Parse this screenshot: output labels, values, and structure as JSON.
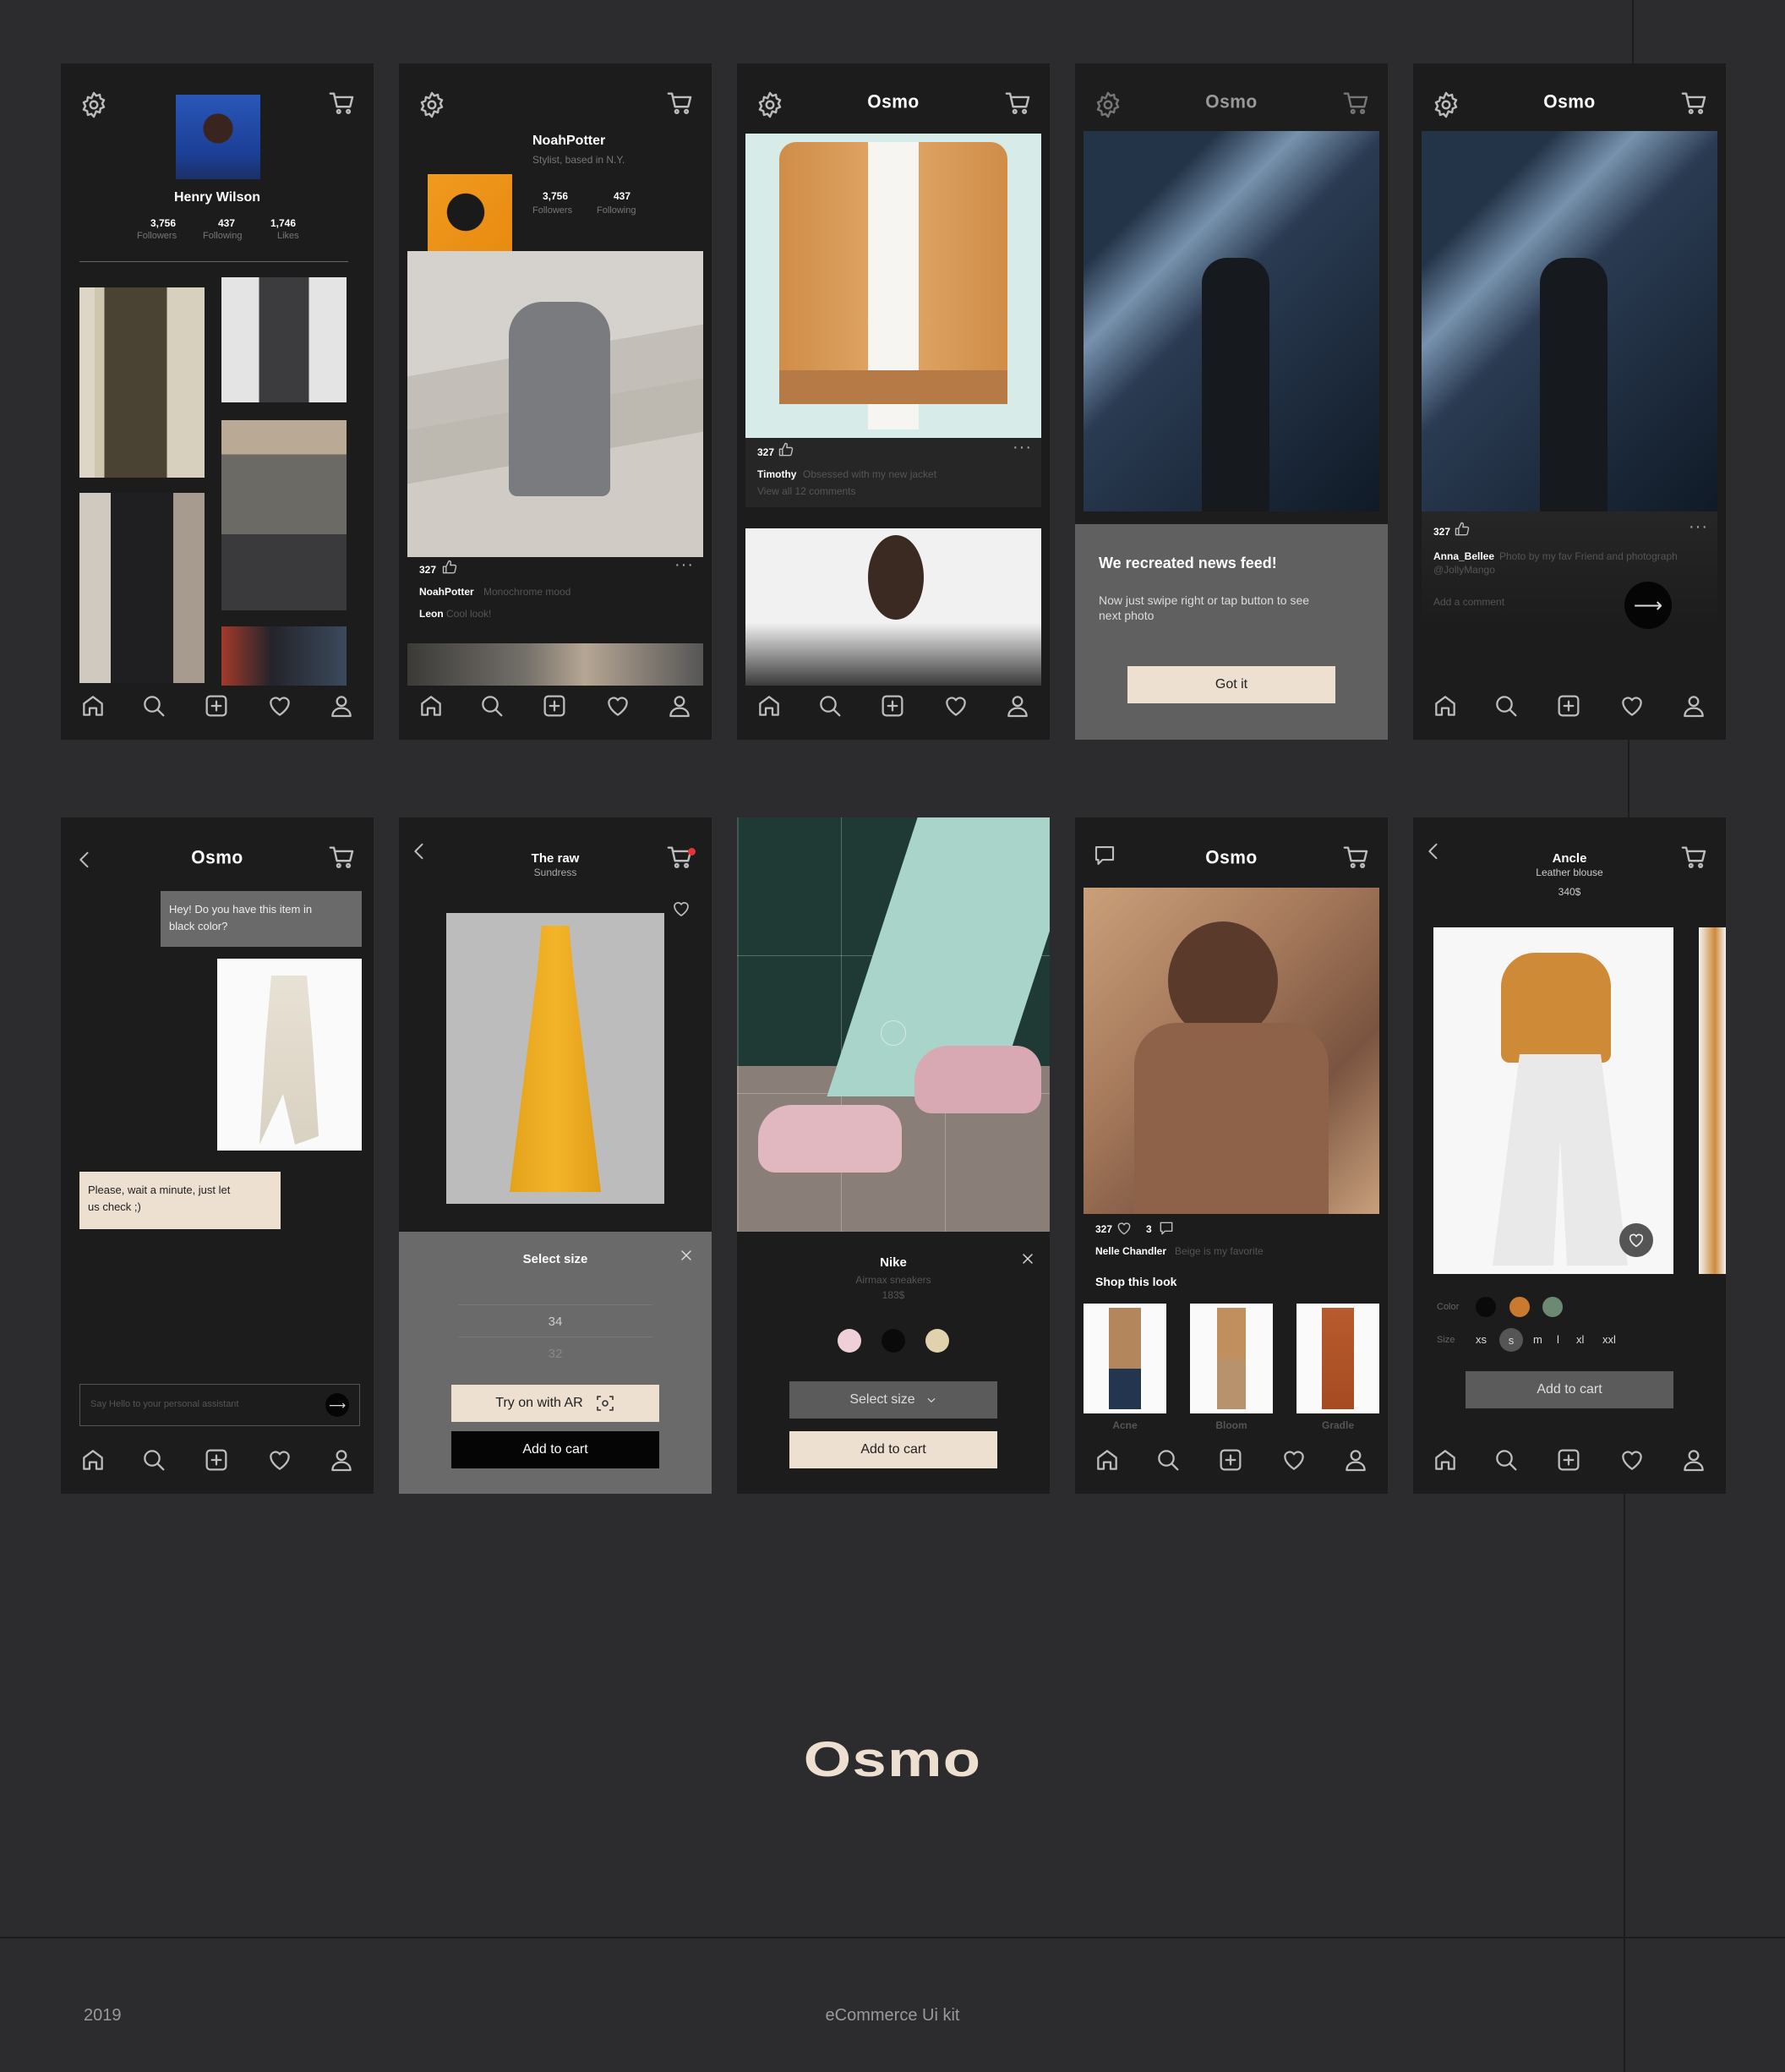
{
  "brand": {
    "name": "Osmo",
    "big_logo": "Osmo"
  },
  "footer": {
    "year": "2019",
    "subtitle": "eCommerce Ui kit"
  },
  "screen1": {
    "name": "Henry Wilson",
    "stats": [
      {
        "num": "3,756",
        "label": "Followers"
      },
      {
        "num": "437",
        "label": "Following"
      },
      {
        "num": "1,746",
        "label": "Likes"
      }
    ]
  },
  "screen2": {
    "name": "NoahPotter",
    "bio": "Stylist, based in N.Y.",
    "stats": [
      {
        "num": "3,756",
        "label": "Followers"
      },
      {
        "num": "437",
        "label": "Following"
      }
    ],
    "likes": "327",
    "post_user": "NoahPotter",
    "post_caption": "Monochrome mood",
    "comment_user": "Leon",
    "comment_text": "Cool look!"
  },
  "screen3": {
    "likes": "327",
    "user": "Timothy",
    "caption": "Obsessed with my new jacket",
    "comments_link": "View all 12 comments"
  },
  "screen4": {
    "title": "We recreated news feed!",
    "text_line1": "Now just swipe right or tap button to see",
    "text_line2": "next photo",
    "button": "Got it"
  },
  "screen5": {
    "likes": "327",
    "user": "Anna_Bellee",
    "caption": "Photo by my fav Friend and photograph",
    "mention": "@JollyMango",
    "comment_placeholder": "Add a comment"
  },
  "screen6": {
    "msg1_line1": "Hey! Do you have this item in",
    "msg1_line2": "black color?",
    "msg2_line1": "Please, wait a minute, just let",
    "msg2_line2": "us check ;)",
    "input_placeholder": "Say Hello to your personal assistant"
  },
  "screen7": {
    "title": "The raw",
    "subtitle": "Sundress",
    "sheet_title": "Select size",
    "sizes": [
      "34",
      "32"
    ],
    "try_ar": "Try on with AR",
    "add_cart": "Add to cart"
  },
  "screen8": {
    "brand": "Nike",
    "product": "Airmax sneakers",
    "price": "183$",
    "colors": [
      "#f0d0d8",
      "#0a0a0a",
      "#dfd2ac"
    ],
    "select_size": "Select size",
    "add_cart": "Add to cart"
  },
  "screen9": {
    "likes": "327",
    "comments": "3",
    "user": "Nelle Chandler",
    "caption": "Beige is my favorite",
    "section": "Shop this look",
    "items": [
      "Acne",
      "Bloom",
      "Gradle"
    ]
  },
  "screen10": {
    "brand": "Ancle",
    "product": "Leather blouse",
    "price": "340$",
    "color_label": "Color",
    "colors": [
      "#0a0a0a",
      "#c97a2e",
      "#6c8a72"
    ],
    "size_label": "Size",
    "sizes": [
      "xs",
      "s",
      "m",
      "l",
      "xl",
      "xxl"
    ],
    "selected_size": "s",
    "add_cart": "Add to cart"
  }
}
